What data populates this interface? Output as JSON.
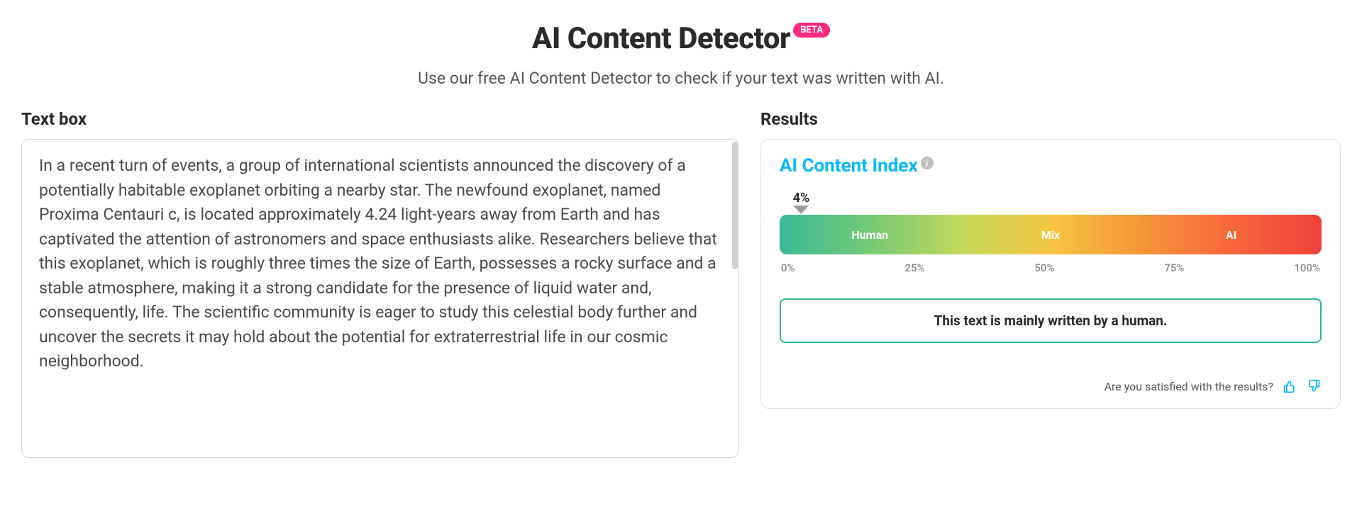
{
  "header": {
    "title": "AI Content Detector",
    "badge": "BETA",
    "subtitle": "Use our free AI Content Detector to check if your text was written with AI."
  },
  "textbox": {
    "label": "Text box",
    "value": "In a recent turn of events, a group of international scientists announced the discovery of a potentially habitable exoplanet orbiting a nearby star. The newfound exoplanet, named Proxima Centauri c, is located approximately 4.24 light-years away from Earth and has captivated the attention of astronomers and space enthusiasts alike. Researchers believe that this exoplanet, which is roughly three times the size of Earth, possesses a rocky surface and a stable atmosphere, making it a strong candidate for the presence of liquid water and, consequently, life. The scientific community is eager to study this celestial body further and uncover the secrets it may hold about the potential for extraterrestrial life in our cosmic neighborhood."
  },
  "results": {
    "label": "Results",
    "index_title": "AI Content Index",
    "percent_value": 4,
    "percent_label": "4%",
    "gauge_segments": {
      "human": "Human",
      "mix": "Mix",
      "ai": "AI"
    },
    "ticks": [
      "0%",
      "25%",
      "50%",
      "75%",
      "100%"
    ],
    "verdict": "This text is mainly written by a human.",
    "feedback_prompt": "Are you satisfied with the results?"
  }
}
